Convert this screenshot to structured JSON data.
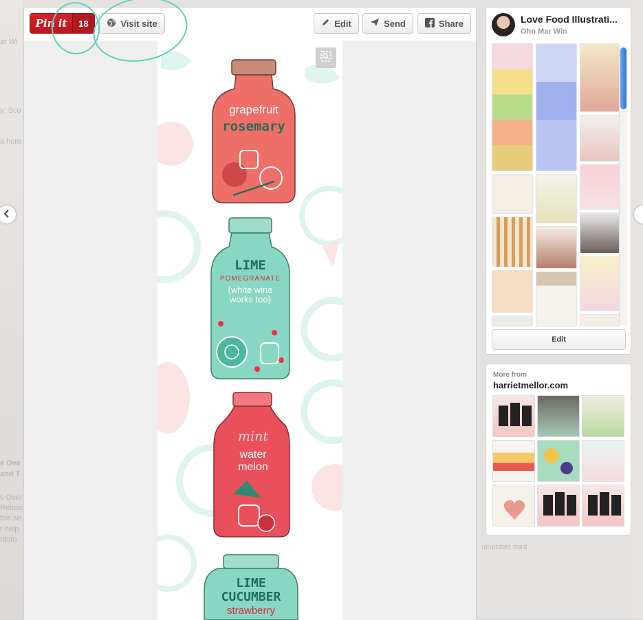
{
  "background": {
    "snippets": [
      "ar Wi",
      "y: Sco",
      "a hom",
      "e Ove",
      "and T",
      "s Over",
      "Reboo",
      "bre se",
      "r help",
      "rdsto",
      "ucumber mint"
    ]
  },
  "pin": {
    "pinit_label": "Pin it",
    "repin_count": "18",
    "visit_site_label": "Visit site",
    "edit_label": "Edit",
    "send_label": "Send",
    "share_label": "Share",
    "bottles": [
      {
        "line1": "grapefruit",
        "line2": "rosemary",
        "line3": ""
      },
      {
        "line1": "LIME",
        "line2": "POMEGRANATE",
        "line3": "(white wine works too)"
      },
      {
        "line1": "mint",
        "line2": "water melon",
        "line3": ""
      },
      {
        "line1": "LIME",
        "line2": "CUCUMBER",
        "line3": "strawberry"
      }
    ]
  },
  "board": {
    "title": "Love Food Illustrati...",
    "owner": "Ohn Mar Win",
    "edit_label": "Edit"
  },
  "more_from": {
    "label": "More from",
    "site": "harrietmellor.com"
  },
  "colors": {
    "pinit_red": "#c8202a",
    "annotation_teal": "#5fd0bd",
    "scroll_blue": "#3b82e0",
    "grapefruit": "#e9645e",
    "lime": "#7fd2bd",
    "watermelon": "#e64e5a"
  },
  "icons": {
    "pinit": "pinterest-logo",
    "visit": "globe-icon",
    "edit": "pencil-icon",
    "send": "paper-plane-icon",
    "share": "facebook-icon",
    "zoom": "zoom-icon",
    "prev": "chevron-left-icon"
  }
}
